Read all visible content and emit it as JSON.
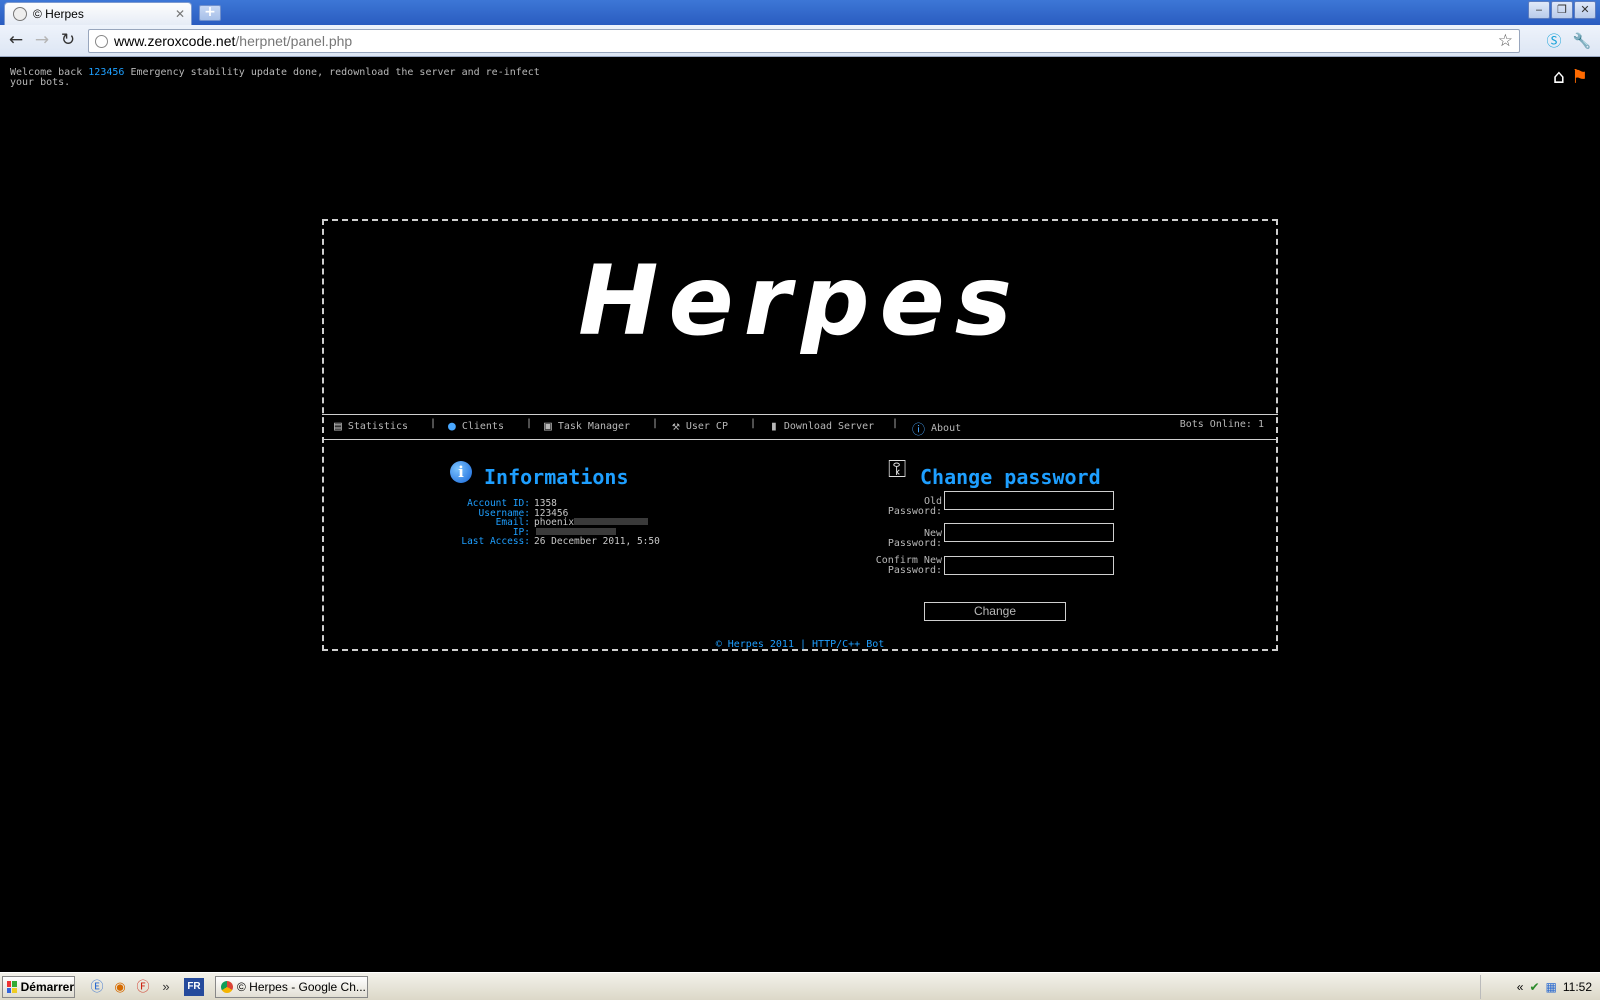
{
  "browser": {
    "tab_title": "© Herpes",
    "tab_close": "✕",
    "new_tab": "+",
    "url_host": "www.zeroxcode.net",
    "url_path": "/herpnet/panel.php",
    "window_controls": [
      "‒",
      "❐",
      "✕"
    ]
  },
  "header": {
    "welcome_prefix": "Welcome back",
    "username": "123456",
    "message": "Emergency stability update done, redownload the server and re-infect your bots."
  },
  "panel": {
    "logo": "Herpes",
    "nav": [
      {
        "label": "Statistics",
        "icon": "chart-icon"
      },
      {
        "label": "Clients",
        "icon": "user-icon"
      },
      {
        "label": "Task Manager",
        "icon": "task-icon"
      },
      {
        "label": "User CP",
        "icon": "wrench-icon"
      },
      {
        "label": "Download Server",
        "icon": "server-icon"
      },
      {
        "label": "About",
        "icon": "info-icon"
      }
    ],
    "nav_separator": "|",
    "bots_online": "Bots Online: 1",
    "informations": {
      "title": "Informations",
      "info_icon_glyph": "i",
      "rows": [
        {
          "label": "Account ID:",
          "value": "1358"
        },
        {
          "label": "Username:",
          "value": "123456"
        },
        {
          "label": "Email:",
          "value": "phoenix"
        },
        {
          "label": "IP:",
          "value": ""
        },
        {
          "label": "Last Access:",
          "value": "26 December 2011, 5:50"
        }
      ]
    },
    "change_password": {
      "title": "Change password",
      "old_label": "Old Password:",
      "new_label": "New Password:",
      "confirm_label": "Confirm New Password:",
      "button": "Change"
    },
    "footer": "© Herpes 2011 | HTTP/C++ Bot"
  },
  "taskbar": {
    "start": "Démarrer",
    "lang": "FR",
    "more": "»",
    "app_label": "© Herpes - Google Ch...",
    "tray_expand": "«",
    "clock": "11:52"
  }
}
